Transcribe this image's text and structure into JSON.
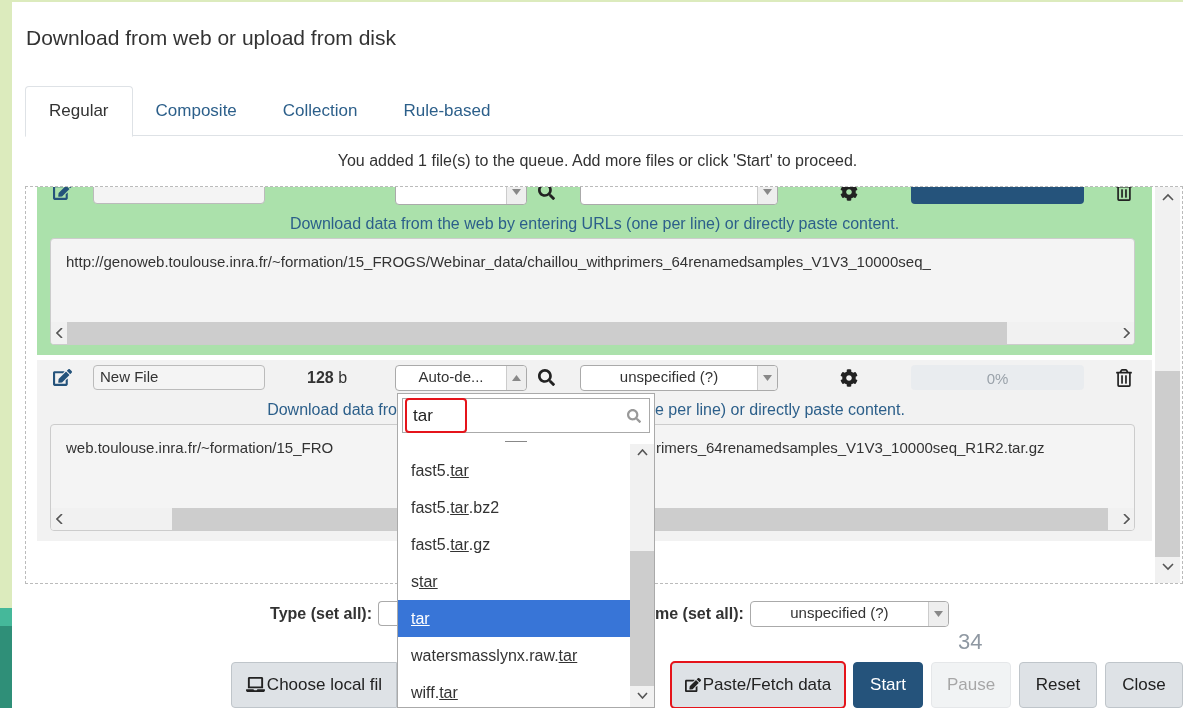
{
  "title": "Download from web or upload from disk",
  "tabs": [
    {
      "label": "Regular",
      "selected": true
    },
    {
      "label": "Composite",
      "selected": false
    },
    {
      "label": "Collection",
      "selected": false
    },
    {
      "label": "Rule-based",
      "selected": false
    }
  ],
  "queue_message": "You added 1 file(s) to the queue. Add more files or click 'Start' to proceed.",
  "uploads": [
    {
      "done": true,
      "expanded": false,
      "level": 1,
      "hint_parts": [
        "Download data from the web by entering URLs (one per line) or directly paste content."
      ],
      "content_parts": [
        "http://genoweb.toulouse.inra.fr/~formation/15_FROGS/Webinar_data/chaillou_withprimers_64renamedsamples_V1V3_10000seq_"
      ]
    },
    {
      "done": false,
      "name": "New File",
      "size": "128 b",
      "type": "Auto-de...",
      "expanded": true,
      "genome": "unspecified (?)",
      "progress_label": "0%",
      "level": 0,
      "hint_parts": [
        "Download data fro",
        "e per line) or directly paste content."
      ],
      "content_parts": [
        "web.toulouse.inra.fr/~formation/15_FRO",
        "rimers_64renamedsamples_V1V3_10000seq_R1R2.tar.gz"
      ]
    }
  ],
  "type_dropdown": {
    "query": "tar",
    "highlighted": true,
    "options": [
      {
        "before": "fast5.",
        "match": "tar",
        "selected": false
      },
      {
        "before": "fast5.",
        "match": "tar",
        "after": ".bz2",
        "selected": false
      },
      {
        "before": "fast5.",
        "match": "tar",
        "after": ".gz",
        "selected": false
      },
      {
        "before": "s",
        "match": "tar",
        "selected": false
      },
      {
        "match": "tar",
        "selected": true
      },
      {
        "before": "watersmasslynx.raw.",
        "match": "tar",
        "selected": false
      },
      {
        "before": "wiff.",
        "match": "tar",
        "selected": false
      }
    ]
  },
  "set_all": {
    "type_label": "Type (set all):",
    "genome_label": "me (set all):",
    "genome_value": "unspecified (?)"
  },
  "buttons": [
    {
      "label": "Choose local fil",
      "kind": "local",
      "highlighted": false,
      "disabled": false
    },
    {
      "label": "Paste/Fetch data",
      "kind": "paste",
      "highlighted": true,
      "disabled": false
    },
    {
      "label": "Start",
      "kind": "primary",
      "highlighted": false,
      "disabled": false
    },
    {
      "label": "Pause",
      "kind": "plain",
      "highlighted": false,
      "disabled": true
    },
    {
      "label": "Reset",
      "kind": "plain",
      "highlighted": false,
      "disabled": false
    },
    {
      "label": "Close",
      "kind": "plain",
      "highlighted": false,
      "disabled": false
    }
  ],
  "slide_number": "34"
}
